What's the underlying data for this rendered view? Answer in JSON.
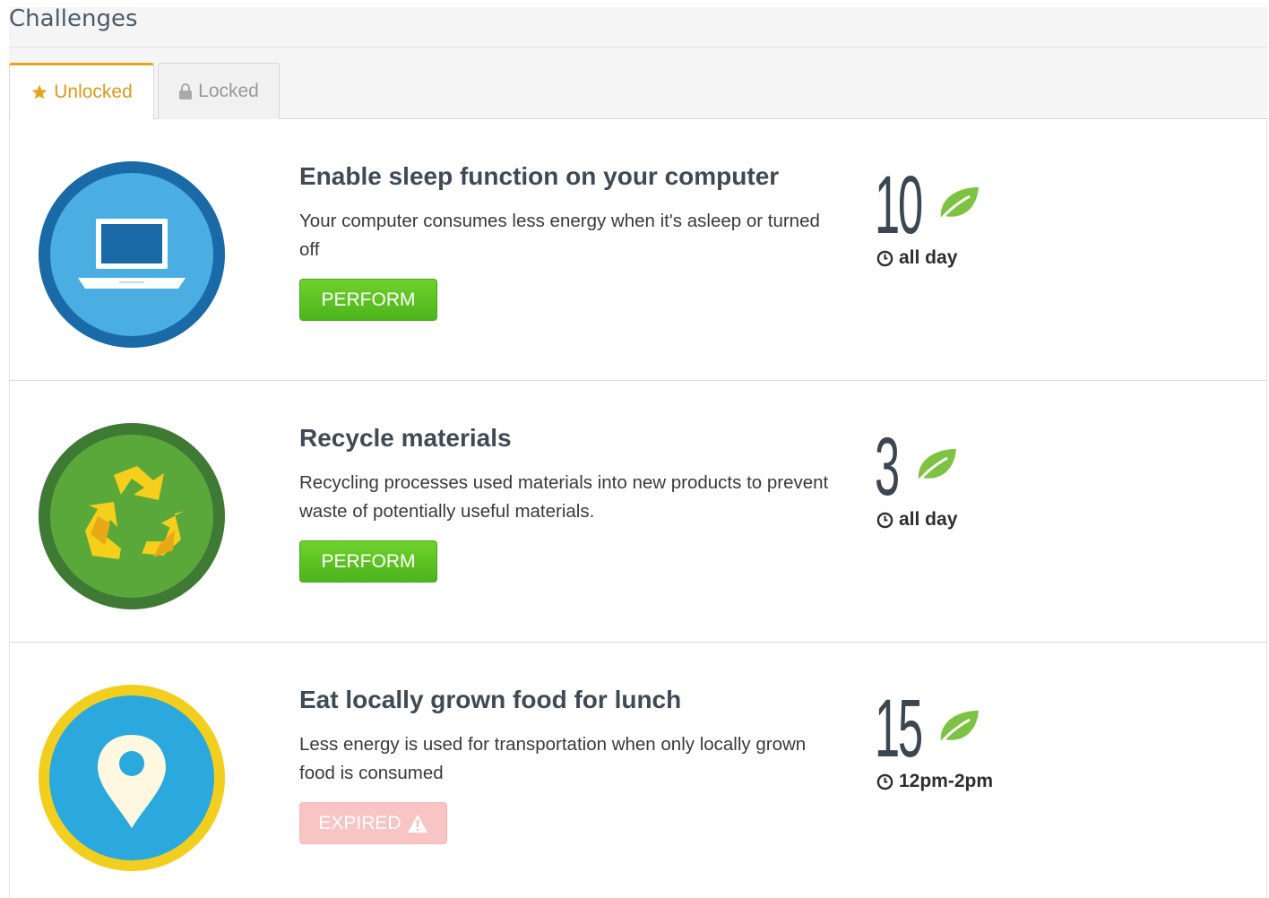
{
  "page": {
    "title": "Challenges"
  },
  "tabs": [
    {
      "label": "Unlocked",
      "icon": "star-icon",
      "active": true
    },
    {
      "label": "Locked",
      "icon": "lock-icon",
      "active": false
    }
  ],
  "colors": {
    "accent_tab": "#e3a51f",
    "perform_button": "#5cc423",
    "expired_button": "#f8c4c4",
    "leaf": "#7dc242",
    "points": "#3b4650"
  },
  "challenges": [
    {
      "title": "Enable sleep function on your computer",
      "description": "Your computer consumes less energy when it's asleep or turned off",
      "button_label": "PERFORM",
      "points": "10",
      "time": "all day",
      "badge_icon": "laptop-icon"
    },
    {
      "title": "Recycle materials",
      "description": "Recycling processes used materials into new products to prevent waste of potentially useful materials.",
      "button_label": "PERFORM",
      "points": "3",
      "time": "all day",
      "badge_icon": "recycle-icon"
    },
    {
      "title": "Eat locally grown food for lunch",
      "description": "Less energy is used for transportation when only locally grown food is consumed",
      "button_label": "EXPIRED",
      "points": "15",
      "time": "12pm-2pm",
      "badge_icon": "map-pin-icon"
    }
  ]
}
